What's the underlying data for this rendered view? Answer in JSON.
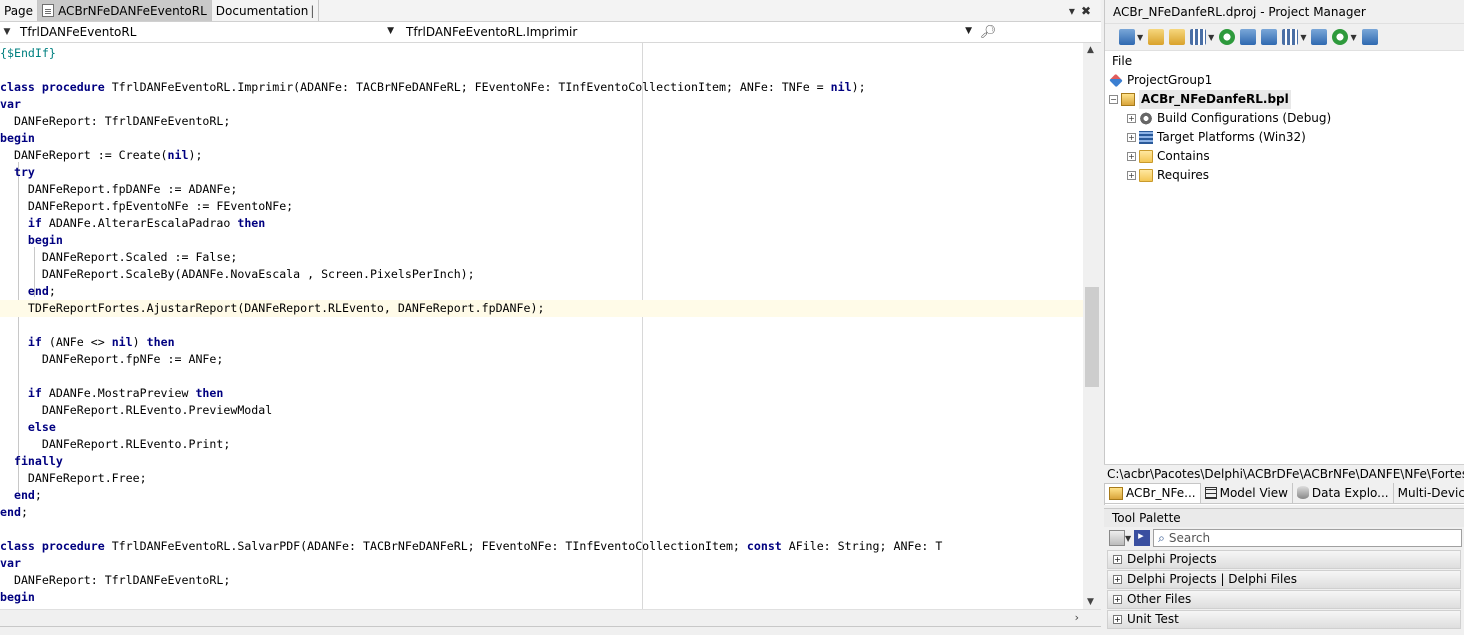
{
  "editor": {
    "tabs": [
      {
        "label": "Page",
        "active": false
      },
      {
        "label": "ACBrNFeDANFeEventoRL",
        "active": true
      },
      {
        "label": "Documentation",
        "active": false
      }
    ],
    "tab_pipe": "|",
    "tab_dropdown_glyph": "▾",
    "tab_close_glyph": "✖",
    "nav": {
      "class_combo": "TfrlDANFeEventoRL",
      "method_combo": "TfrlDANFeEventoRL.Imprimir"
    },
    "code_lines": [
      "{$EndIf}",
      "",
      "class procedure TfrlDANFeEventoRL.Imprimir(ADANFe: TACBrNFeDANFeRL; FEventoNFe: TInfEventoCollectionItem; ANFe: TNFe = nil);",
      "var",
      "  DANFeReport: TfrlDANFeEventoRL;",
      "begin",
      "  DANFeReport := Create(nil);",
      "  try",
      "    DANFeReport.fpDANFe := ADANFe;",
      "    DANFeReport.fpEventoNFe := FEventoNFe;",
      "    if ADANFe.AlterarEscalaPadrao then",
      "    begin",
      "      DANFeReport.Scaled := False;",
      "      DANFeReport.ScaleBy(ADANFe.NovaEscala , Screen.PixelsPerInch);",
      "    end;",
      "    TDFeReportFortes.AjustarReport(DANFeReport.RLEvento, DANFeReport.fpDANFe);",
      "",
      "    if (ANFe <> nil) then",
      "      DANFeReport.fpNFe := ANFe;",
      "",
      "    if ADANFe.MostraPreview then",
      "      DANFeReport.RLEvento.PreviewModal",
      "    else",
      "      DANFeReport.RLEvento.Print;",
      "  finally",
      "    DANFeReport.Free;",
      "  end;",
      "end;",
      "",
      "class procedure TfrlDANFeEventoRL.SalvarPDF(ADANFe: TACBrNFeDANFeRL; FEventoNFe: TInfEventoCollectionItem; const AFile: String; ANFe: T",
      "var",
      "  DANFeReport: TfrlDANFeEventoRL;",
      "begin"
    ]
  },
  "project_manager": {
    "title": "ACBr_NFeDanfeRL.dproj - Project Manager",
    "menu_file": "File",
    "tree": [
      {
        "label": "ProjectGroup1",
        "icon": "project-group-icon"
      },
      {
        "label": "ACBr_NFeDanfeRL.bpl",
        "icon": "package-icon"
      },
      {
        "label": "Build Configurations (Debug)",
        "icon": "gear-icon"
      },
      {
        "label": "Target Platforms (Win32)",
        "icon": "platforms-icon"
      },
      {
        "label": "Contains",
        "icon": "folder-icon"
      },
      {
        "label": "Requires",
        "icon": "folder-icon"
      }
    ],
    "path": "C:\\acbr\\Pacotes\\Delphi\\ACBrDFe\\ACBrNFe\\DANFE\\NFe\\Fortes\\AC",
    "bottom_tabs": [
      "ACBr_NFe...",
      "Model View",
      "Data Explo...",
      "Multi-Device"
    ]
  },
  "tool_palette": {
    "title": "Tool Palette",
    "search_placeholder": "Search",
    "categories": [
      "Delphi Projects",
      "Delphi Projects | Delphi Files",
      "Other Files",
      "Unit Test"
    ]
  },
  "colors": {
    "keyword": "#000080",
    "directive": "#008080",
    "highlight_line": "#fffbe8"
  }
}
